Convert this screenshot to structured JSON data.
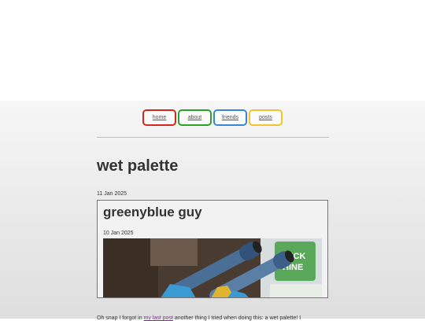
{
  "nav": {
    "home": "home",
    "about": "about",
    "friends": "friends",
    "posts": "posts"
  },
  "post": {
    "title": "wet palette",
    "date": "11 Jan 2025"
  },
  "embed": {
    "title": "greenyblue guy",
    "date": "10 Jan 2025",
    "photo_label": "QUICK SHINE"
  },
  "paragraph": {
    "before_link": "Oh snap I forgot in ",
    "link": "my last post",
    "after_link": " another thing I tried when doing this: a wet palette! I"
  },
  "colors": {
    "home": "#d3271b",
    "about": "#2aa22a",
    "friends": "#3a86d6",
    "posts": "#f1c232",
    "link": "#7b2f8c"
  }
}
